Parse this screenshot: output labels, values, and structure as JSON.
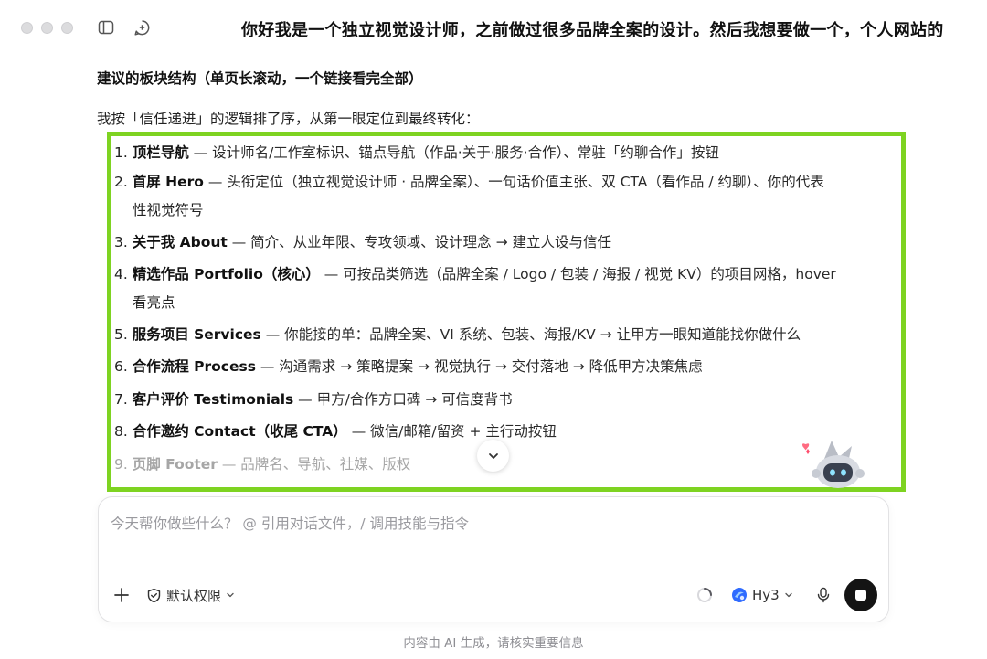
{
  "window": {
    "title": "你好我是一个独立视觉设计师，之前做过很多品牌全案的设计。然后我想要做一个，个人网站的"
  },
  "content": {
    "heading": "建议的板块结构（单页长滚动，一个链接看完全部）",
    "intro": "我按「信任递进」的逻辑排了序，从第一眼定位到最终转化：",
    "items": [
      {
        "num": "1. ",
        "name": "顶栏导航",
        "desc": " — 设计师名/工作室标识、锚点导航（作品·关于·服务·合作）、常驻「约聊合作」按钮",
        "cont": ""
      },
      {
        "num": "2. ",
        "name": "首屏 Hero",
        "desc": " — 头衔定位（独立视觉设计师 · 品牌全案）、一句话价值主张、双 CTA（看作品 / 约聊）、你的代表",
        "cont": "性视觉符号"
      },
      {
        "num": "3. ",
        "name": "关于我 About",
        "desc": " — 简介、从业年限、专攻领域、设计理念 → 建立人设与信任",
        "cont": ""
      },
      {
        "num": "4. ",
        "name": "精选作品 Portfolio（核心）",
        "desc": " — 可按品类筛选（品牌全案 / Logo / 包装 / 海报 / 视觉 KV）的项目网格，hover",
        "cont": "看亮点"
      },
      {
        "num": "5. ",
        "name": "服务项目 Services",
        "desc": " — 你能接的单：品牌全案、VI 系统、包装、海报/KV → 让甲方一眼知道能找你做什么",
        "cont": ""
      },
      {
        "num": "6. ",
        "name": "合作流程 Process",
        "desc": " — 沟通需求 → 策略提案 → 视觉执行 → 交付落地 → 降低甲方决策焦虑",
        "cont": ""
      },
      {
        "num": "7. ",
        "name": "客户评价 Testimonials",
        "desc": " — 甲方/合作方口碑 → 可信度背书",
        "cont": ""
      },
      {
        "num": "8. ",
        "name": "合作邀约 Contact（收尾 CTA）",
        "desc": " — 微信/邮箱/留资 + 主行动按钮",
        "cont": ""
      },
      {
        "num": "9. ",
        "name": "页脚 Footer",
        "desc": " — 品牌名、导航、社媒、版权",
        "cont": ""
      }
    ]
  },
  "composer": {
    "placeholder": "今天帮你做些什么？ @ 引用对话文件，/ 调用技能与指令",
    "value": "",
    "permission_label": "默认权限",
    "model_label": "Hy3"
  },
  "footer": {
    "disclaimer": "内容由 AI 生成，请核实重要信息"
  },
  "icons": {
    "close": "window-close-icon",
    "minimize": "window-minimize-icon",
    "maximize": "window-maximize-icon",
    "sidebar": "sidebar-toggle-icon",
    "new_chat": "new-chat-icon",
    "scroll_down": "chevron-down-icon",
    "plus": "plus-icon",
    "shield": "shield-check-icon",
    "spinner": "loading-spinner-icon",
    "model": "model-logo-icon",
    "mic": "microphone-icon",
    "stop": "stop-icon"
  },
  "colors": {
    "highlight_frame": "#7ed321",
    "stop_button": "#141414",
    "model_logo": "#2f6bff"
  }
}
